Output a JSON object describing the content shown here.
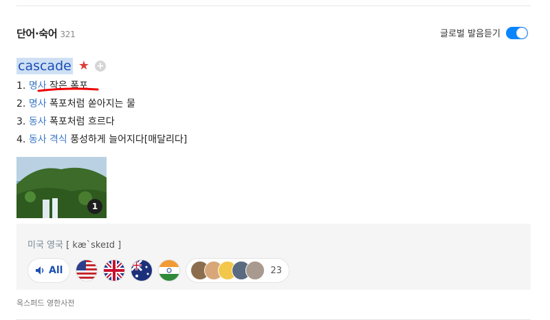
{
  "section": {
    "title": "단어·숙어",
    "count": "321"
  },
  "global_listen": {
    "label": "글로벌 발음듣기",
    "enabled": true
  },
  "entry": {
    "word": "cascade",
    "star_icon": "star-icon",
    "add_icon": "plus-icon",
    "meanings": [
      {
        "num": "1.",
        "pos": "명사",
        "text": "작은 폭포"
      },
      {
        "num": "2.",
        "pos": "명사",
        "text": "폭포처럼 쏟아지는 물"
      },
      {
        "num": "3.",
        "pos": "동사",
        "text": "폭포처럼 흐르다"
      },
      {
        "num": "4.",
        "pos": "동사 격식",
        "text": "풍성하게 늘어지다[매달리다]"
      }
    ],
    "image_count": "1"
  },
  "pronunciation": {
    "region": "미국 영국",
    "ipa": "[ kæˋskeɪd ]",
    "all_label": "All",
    "flags": [
      "us-flag-icon",
      "uk-flag-icon",
      "au-flag-icon",
      "in-flag-icon"
    ],
    "user_count": "23"
  },
  "source": "옥스퍼드 영한사전",
  "colors": {
    "accent": "#0a84ff",
    "pos": "#3c78c8",
    "star": "#e03c3c"
  }
}
